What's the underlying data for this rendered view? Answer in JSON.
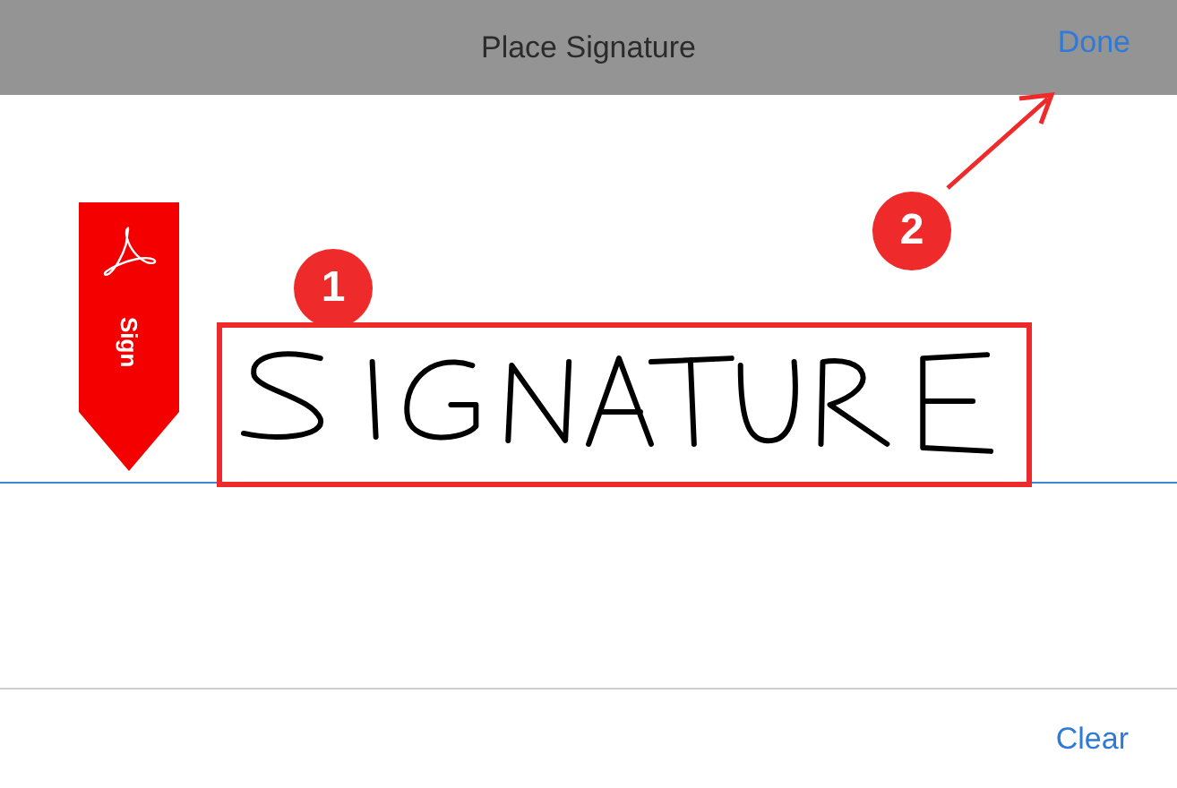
{
  "header": {
    "title": "Place Signature",
    "done_label": "Done"
  },
  "sign_tab": {
    "label": "Sign"
  },
  "annotations": [
    {
      "number": "1"
    },
    {
      "number": "2"
    }
  ],
  "footer": {
    "clear_label": "Clear"
  }
}
